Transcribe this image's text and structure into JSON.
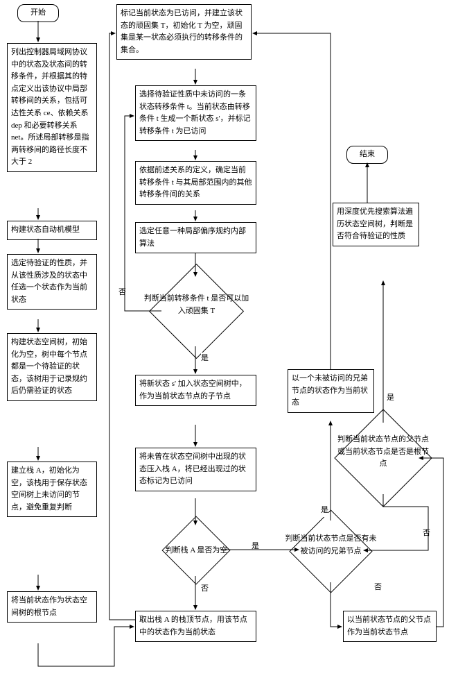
{
  "terminals": {
    "start": "开始",
    "end": "结束"
  },
  "left_column": {
    "a1": "列出控制器局域网协议中的状态及状态间的转移条件，并根据其的特点定义出该协议中局部转移间的关系，包括可达性关系 ce、依赖关系 dep 和必要转移关系 net。所述局部转移是指两转移间的路径长度不大于 2",
    "a2": "构建状态自动机模型",
    "a3": "选定待验证的性质，并从该性质涉及的状态中任选一个状态作为当前状态",
    "a4": "构建状态空间树，初始化为空，树中每个节点都是一个待验证的状态，该树用于记录规约后仍需验证的状态",
    "a5": "建立栈 A，初始化为空，该栈用于保存状态空间树上未访问的节点，避免重复判断",
    "a6": "将当前状态作为状态空间树的根节点"
  },
  "middle_column": {
    "b1": "标记当前状态为已访问，并建立该状态的顽固集 T，初始化 T 为空，顽固集是某一状态必须执行的转移条件的集合。",
    "b2": "选择待验证性质中未访问的一条状态转移条件 t。当前状态由转移条件 t 生成一个新状态 s'，并标记转移条件 t 为已访问",
    "b3": "依据前述关系的定义，确定当前转移条件 t 与其局部范围内的其他转移条件间的关系",
    "b4": "选定任意一种局部偏序规约内部算法",
    "d1": "判断当前转移条件 t 是否可以加入顽固集 T",
    "b5": "将新状态 s' 加入状态空间树中，作为当前状态节点的子节点",
    "b6": "将未曾在状态空间树中出现的状态压入栈 A，将已经出现过的状态标记为已访问",
    "d2": "判断栈 A 是否为空",
    "b7": "取出栈 A 的栈顶节点，用该节点中的状态作为当前状态"
  },
  "right_column": {
    "c1": "以一个未被访问的兄弟节点的状态作为当前状态",
    "d3": "判断当前状态节点是否有未被访问的兄弟节点",
    "c2": "以当前状态节点的父节点作为当前状态节点",
    "d4": "判断当前状态节点的父节点或当前状态节点是否是根节点",
    "c3": "用深度优先搜索算法遍历状态空间树，判断是否符合待验证的性质"
  },
  "labels": {
    "yes": "是",
    "no": "否"
  },
  "chart_data": {
    "type": "other",
    "note": "Flowchart depicting state-space reduction and verification process for controller LAN protocol using partial-order reduction and DFS traversal.",
    "start": "开始",
    "end": "结束",
    "nodes": [
      {
        "id": "a1",
        "type": "process",
        "col": "left"
      },
      {
        "id": "a2",
        "type": "process",
        "col": "left"
      },
      {
        "id": "a3",
        "type": "process",
        "col": "left"
      },
      {
        "id": "a4",
        "type": "process",
        "col": "left"
      },
      {
        "id": "a5",
        "type": "process",
        "col": "left"
      },
      {
        "id": "a6",
        "type": "process",
        "col": "left"
      },
      {
        "id": "b1",
        "type": "process",
        "col": "mid"
      },
      {
        "id": "b2",
        "type": "process",
        "col": "mid"
      },
      {
        "id": "b3",
        "type": "process",
        "col": "mid"
      },
      {
        "id": "b4",
        "type": "process",
        "col": "mid"
      },
      {
        "id": "d1",
        "type": "decision",
        "col": "mid"
      },
      {
        "id": "b5",
        "type": "process",
        "col": "mid"
      },
      {
        "id": "b6",
        "type": "process",
        "col": "mid"
      },
      {
        "id": "d2",
        "type": "decision",
        "col": "mid"
      },
      {
        "id": "b7",
        "type": "process",
        "col": "mid"
      },
      {
        "id": "c1",
        "type": "process",
        "col": "right"
      },
      {
        "id": "d3",
        "type": "decision",
        "col": "right"
      },
      {
        "id": "c2",
        "type": "process",
        "col": "right"
      },
      {
        "id": "d4",
        "type": "decision",
        "col": "right"
      },
      {
        "id": "c3",
        "type": "process",
        "col": "right"
      }
    ],
    "edges": [
      {
        "from": "开始",
        "to": "a1"
      },
      {
        "from": "a1",
        "to": "a2"
      },
      {
        "from": "a2",
        "to": "a3"
      },
      {
        "from": "a3",
        "to": "a4"
      },
      {
        "from": "a4",
        "to": "a5"
      },
      {
        "from": "a5",
        "to": "a6"
      },
      {
        "from": "a6",
        "to": "b7"
      },
      {
        "from": "b7",
        "to": "b1"
      },
      {
        "from": "b1",
        "to": "b2"
      },
      {
        "from": "b2",
        "to": "b3"
      },
      {
        "from": "b3",
        "to": "b4"
      },
      {
        "from": "b4",
        "to": "d1"
      },
      {
        "from": "d1",
        "to": "b5",
        "label": "是"
      },
      {
        "from": "d1",
        "to": "b2",
        "label": "否"
      },
      {
        "from": "b5",
        "to": "b6"
      },
      {
        "from": "b6",
        "to": "d2"
      },
      {
        "from": "d2",
        "to": "b7",
        "label": "否"
      },
      {
        "from": "d2",
        "to": "d3",
        "label": "是"
      },
      {
        "from": "d3",
        "to": "c1",
        "label": "是"
      },
      {
        "from": "d3",
        "to": "c2",
        "label": "否"
      },
      {
        "from": "c2",
        "to": "d4"
      },
      {
        "from": "d4",
        "to": "d3",
        "label": "否"
      },
      {
        "from": "d4",
        "to": "c3",
        "label": "是"
      },
      {
        "from": "c1",
        "to": "b1"
      },
      {
        "from": "c3",
        "to": "结束"
      }
    ]
  }
}
